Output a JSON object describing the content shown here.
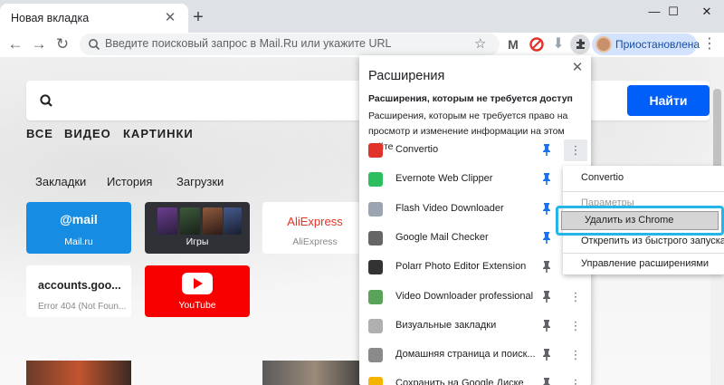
{
  "tab": {
    "title": "Новая вкладка",
    "close": "✕",
    "new_tab": "+"
  },
  "window_controls": {
    "minimize": "—",
    "maximize": "☐",
    "close": "✕"
  },
  "nav": {
    "back": "←",
    "forward": "→",
    "reload": "↻"
  },
  "omnibox": {
    "placeholder": "Введите поисковый запрос в Mail.Ru или укажите URL",
    "bookmark": "☆"
  },
  "profile": {
    "label": "Приостановлена"
  },
  "menu": {
    "dots": "⋮"
  },
  "page": {
    "search_button": "Найти",
    "categories": [
      "ВСЕ",
      "ВИДЕО",
      "КАРТИНКИ"
    ],
    "quick_links": [
      "Закладки",
      "История",
      "Загрузки"
    ],
    "tiles": {
      "mailru": {
        "logo": "@mail",
        "label": "Mail.ru"
      },
      "games": {
        "label": "Игры"
      },
      "aliexpress": {
        "logo": "AliExpress",
        "label": "AliExpress"
      },
      "accounts": {
        "title": "accounts.goo...",
        "subtitle": "Error 404 (Not Foun..."
      },
      "youtube": {
        "label": "YouTube"
      }
    }
  },
  "extensions_panel": {
    "title": "Расширения",
    "close": "✕",
    "subtitle": "Расширения, которым не требуется доступ",
    "description": "Расширения, которым не требуется право на просмотр и изменение информации на этом сайте",
    "pin_glyph": "📌",
    "more_glyph": "⋮",
    "items": [
      {
        "name": "Convertio",
        "icon": "convertio-icon",
        "icon_color": "#e0332a",
        "pinned": true
      },
      {
        "name": "Evernote Web Clipper",
        "icon": "evernote-icon",
        "icon_color": "#2dbe60",
        "pinned": true
      },
      {
        "name": "Flash Video Downloader",
        "icon": "download-arrow-icon",
        "icon_color": "#9aa5b1",
        "pinned": true
      },
      {
        "name": "Google Mail Checker",
        "icon": "gmail-checker-icon",
        "icon_color": "#666666",
        "pinned": true
      },
      {
        "name": "Polarr Photo Editor Extension",
        "icon": "polarr-icon",
        "icon_color": "#333333",
        "pinned": false
      },
      {
        "name": "Video Downloader professional",
        "icon": "video-downloader-icon",
        "icon_color": "#5aa45a",
        "pinned": false
      },
      {
        "name": "Визуальные закладки",
        "icon": "visual-bookmarks-icon",
        "icon_color": "#b0b0b0",
        "pinned": false
      },
      {
        "name": "Домашняя страница и поиск...",
        "icon": "homepage-search-icon",
        "icon_color": "#8a8a8a",
        "pinned": false
      },
      {
        "name": "Сохранить на Google Диске",
        "icon": "google-drive-icon",
        "icon_color": "#f4b400",
        "pinned": false
      }
    ]
  },
  "context_menu": {
    "items": [
      "Convertio",
      "Параметры",
      "Удалить из Chrome",
      "Открепить из быстрого запуска",
      "Управление расширениями"
    ]
  },
  "colors": {
    "accent": "#005ff9",
    "highlight": "#25b5e6",
    "pin_blue": "#1a73e8"
  }
}
